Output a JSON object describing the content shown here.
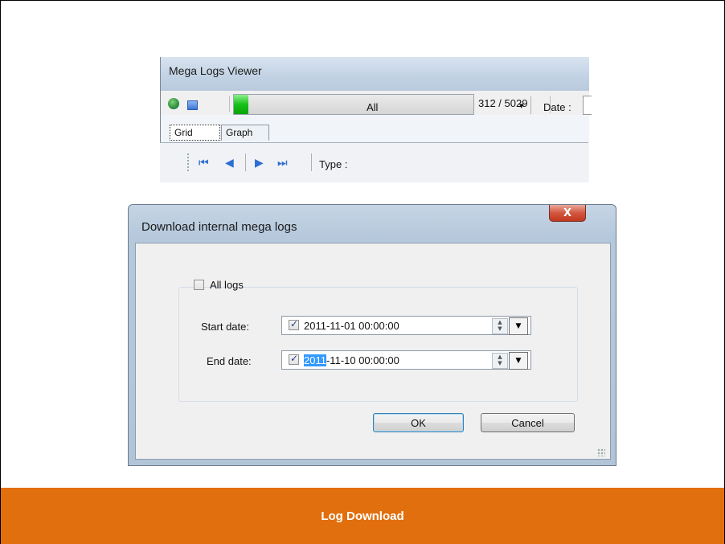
{
  "viewer": {
    "title": "Mega Logs Viewer",
    "progress": {
      "current": 312,
      "total": 5029,
      "label": "312 / 5029"
    },
    "tabs": [
      {
        "label": "Grid",
        "selected": true
      },
      {
        "label": "Graph",
        "selected": false
      }
    ],
    "nav_icons": [
      "first-record-icon",
      "previous-record-icon",
      "next-record-icon",
      "last-record-icon"
    ],
    "type_label": "Type :",
    "type_value": "All",
    "date_label": "Date :"
  },
  "dialog": {
    "title": "Download internal mega logs",
    "close_glyph": "X",
    "all_logs_label": "All logs",
    "all_logs_checked": false,
    "start_date_label": "Start date:",
    "start_date_checked": true,
    "start_date_value": "2011-11-01 00:00:00",
    "end_date_label": "End date:",
    "end_date_checked": true,
    "end_date_selected_part": "2011",
    "end_date_rest": "-11-10 00:00:00",
    "ok_label": "OK",
    "cancel_label": "Cancel"
  },
  "caption": "Log Download",
  "colors": {
    "caption_background": "#e26f0e",
    "selection": "#3399ff",
    "progress_fill": "#18c018"
  }
}
